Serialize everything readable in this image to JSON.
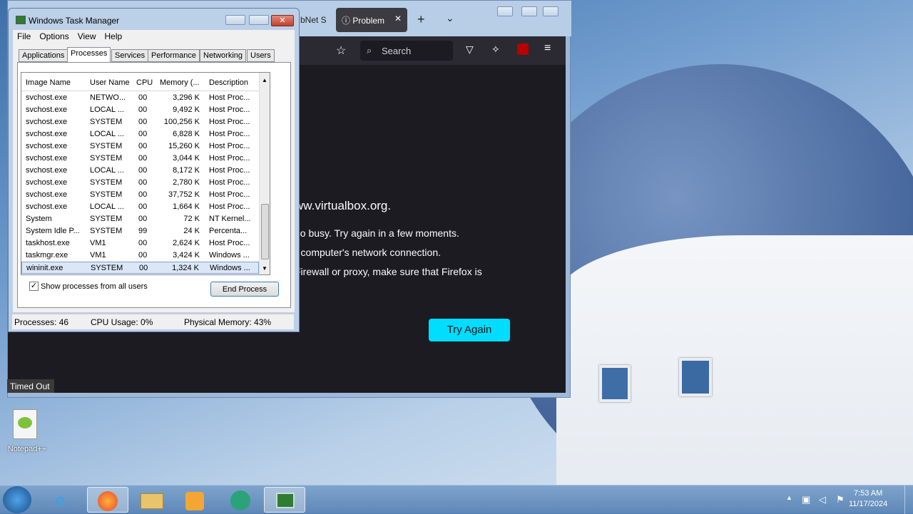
{
  "taskmanager": {
    "title": "Windows Task Manager",
    "menu": [
      "File",
      "Options",
      "View",
      "Help"
    ],
    "tabs": [
      "Applications",
      "Processes",
      "Services",
      "Performance",
      "Networking",
      "Users"
    ],
    "columns": [
      "Image Name",
      "User Name",
      "CPU",
      "Memory (...",
      "Description"
    ],
    "rows": [
      [
        "svchost.exe",
        "NETWO...",
        "00",
        "3,296 K",
        "Host Proc..."
      ],
      [
        "svchost.exe",
        "LOCAL ...",
        "00",
        "9,492 K",
        "Host Proc..."
      ],
      [
        "svchost.exe",
        "SYSTEM",
        "00",
        "100,256 K",
        "Host Proc..."
      ],
      [
        "svchost.exe",
        "LOCAL ...",
        "00",
        "6,828 K",
        "Host Proc..."
      ],
      [
        "svchost.exe",
        "SYSTEM",
        "00",
        "15,260 K",
        "Host Proc..."
      ],
      [
        "svchost.exe",
        "SYSTEM",
        "00",
        "3,044 K",
        "Host Proc..."
      ],
      [
        "svchost.exe",
        "LOCAL ...",
        "00",
        "8,172 K",
        "Host Proc..."
      ],
      [
        "svchost.exe",
        "SYSTEM",
        "00",
        "2,780 K",
        "Host Proc..."
      ],
      [
        "svchost.exe",
        "SYSTEM",
        "00",
        "37,752 K",
        "Host Proc..."
      ],
      [
        "svchost.exe",
        "LOCAL ...",
        "00",
        "1,664 K",
        "Host Proc..."
      ],
      [
        "System",
        "SYSTEM",
        "00",
        "72 K",
        "NT Kernel..."
      ],
      [
        "System Idle P...",
        "SYSTEM",
        "99",
        "24 K",
        "Percenta..."
      ],
      [
        "taskhost.exe",
        "VM1",
        "00",
        "2,624 K",
        "Host Proc..."
      ],
      [
        "taskmgr.exe",
        "VM1",
        "00",
        "3,424 K",
        "Windows ..."
      ],
      [
        "wininit.exe",
        "SYSTEM",
        "00",
        "1,324 K",
        "Windows ..."
      ]
    ],
    "show_all_label": "Show processes from all users",
    "end_process_label": "End Process",
    "status": {
      "processes": "Processes: 46",
      "cpu": "CPU Usage: 0%",
      "memory": "Physical Memory: 43%"
    }
  },
  "firefox": {
    "tab_side_label": "bNet S",
    "tab_label": "Problem",
    "search_placeholder": "Search",
    "lines": [
      "ww.virtualbox.org.",
      "oo busy. Try again in a few moments.",
      "r computer's network connection.",
      "Firewall or proxy, make sure that Firefox is"
    ],
    "try_again_label": "Try Again",
    "status_tooltip": "Timed Out"
  },
  "desktop": {
    "icon_label": "Notepad++"
  },
  "taskbar": {
    "time": "7:53 AM",
    "date": "11/17/2024"
  }
}
